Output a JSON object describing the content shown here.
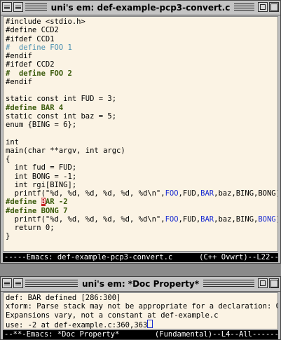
{
  "top_window": {
    "title": "uni's em: def-example-pcp3-convert.c",
    "modeline": "-----Emacs: def-example-pcp3-convert.c      (C++ Ovwrt)--L22--All",
    "code_lines": [
      [
        {
          "t": "#include <stdio.h>",
          "c": ""
        }
      ],
      [
        {
          "t": "#define CCD2",
          "c": ""
        }
      ],
      [
        {
          "t": "#ifdef CCD1",
          "c": ""
        }
      ],
      [
        {
          "t": "#  define FOO 1",
          "c": "cmt"
        }
      ],
      [
        {
          "t": "#endif",
          "c": ""
        }
      ],
      [
        {
          "t": "#ifdef CCD2",
          "c": ""
        }
      ],
      [
        {
          "t": "#  define FOO 2",
          "c": "pp"
        }
      ],
      [
        {
          "t": "#endif",
          "c": ""
        }
      ],
      [
        {
          "t": "",
          "c": ""
        }
      ],
      [
        {
          "t": "static const int FUD = 3;",
          "c": ""
        }
      ],
      [
        {
          "t": "#define BAR 4",
          "c": "pp"
        }
      ],
      [
        {
          "t": "static const int baz = 5;",
          "c": ""
        }
      ],
      [
        {
          "t": "enum {BING = 6};",
          "c": ""
        }
      ],
      [
        {
          "t": "",
          "c": ""
        }
      ],
      [
        {
          "t": "int",
          "c": ""
        }
      ],
      [
        {
          "t": "main(char **argv, int argc)",
          "c": ""
        }
      ],
      [
        {
          "t": "{",
          "c": ""
        }
      ],
      [
        {
          "t": "  int fud = FUD;",
          "c": ""
        }
      ],
      [
        {
          "t": "  int BONG = -1;",
          "c": ""
        }
      ],
      [
        {
          "t": "  int rgi[BING];",
          "c": ""
        }
      ],
      [
        {
          "t": "  printf(\"%d, %d, %d, %d, %d, %d\\n\",",
          "c": ""
        },
        {
          "t": "FOO",
          "c": "blu"
        },
        {
          "t": ",FUD,",
          "c": ""
        },
        {
          "t": "BAR",
          "c": "blu"
        },
        {
          "t": ",baz,BING,BONG);",
          "c": ""
        }
      ],
      [
        {
          "t": "#define ",
          "c": "pp"
        },
        {
          "t": "B",
          "c": "cursor"
        },
        {
          "t": "AR -2",
          "c": "pp"
        }
      ],
      [
        {
          "t": "#define BONG 7",
          "c": "pp"
        }
      ],
      [
        {
          "t": "  printf(\"%d, %d, %d, %d, %d, %d\\n\",",
          "c": ""
        },
        {
          "t": "FOO",
          "c": "blu"
        },
        {
          "t": ",FUD,",
          "c": ""
        },
        {
          "t": "BAR",
          "c": "blu"
        },
        {
          "t": ",baz,BING,",
          "c": ""
        },
        {
          "t": "BONG",
          "c": "blu"
        },
        {
          "t": ");",
          "c": ""
        }
      ],
      [
        {
          "t": "  return 0;",
          "c": ""
        }
      ],
      [
        {
          "t": "}",
          "c": ""
        }
      ]
    ]
  },
  "bottom_window": {
    "title": "uni's em: *Doc Property*",
    "lines": [
      "def: BAR defined [286:300]",
      "xform: Parse stack may not be appropriate for a declaration: 0 2$",
      "Expansions vary, not a constant at def-example.c",
      "use: -2 at def-example.c:360,363"
    ],
    "modeline": "--**-Emacs: *Doc Property*        (Fundamental)--L4--All--------------"
  },
  "icons": {
    "window_menu": "menu-lines-icon",
    "iconify": "iconify-icon",
    "maximize": "maximize-icon"
  }
}
